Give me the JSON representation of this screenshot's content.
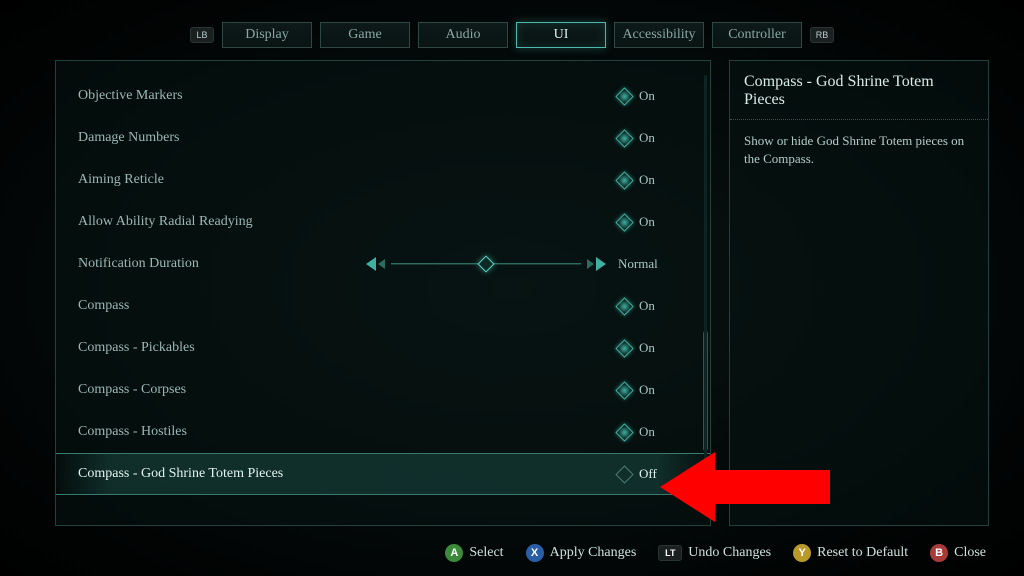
{
  "tabs": {
    "lb": "LB",
    "rb": "RB",
    "items": [
      "Display",
      "Game",
      "Audio",
      "UI",
      "Accessibility",
      "Controller"
    ],
    "active_index": 3
  },
  "settings": [
    {
      "label": "Objective Markers",
      "kind": "toggle",
      "value": "On",
      "on": true
    },
    {
      "label": "Damage Numbers",
      "kind": "toggle",
      "value": "On",
      "on": true
    },
    {
      "label": "Aiming Reticle",
      "kind": "toggle",
      "value": "On",
      "on": true
    },
    {
      "label": "Allow Ability Radial Readying",
      "kind": "toggle",
      "value": "On",
      "on": true
    },
    {
      "label": "Notification Duration",
      "kind": "slider",
      "value": "Normal"
    },
    {
      "label": "Compass",
      "kind": "toggle",
      "value": "On",
      "on": true
    },
    {
      "label": "Compass - Pickables",
      "kind": "toggle",
      "value": "On",
      "on": true
    },
    {
      "label": "Compass - Corpses",
      "kind": "toggle",
      "value": "On",
      "on": true
    },
    {
      "label": "Compass - Hostiles",
      "kind": "toggle",
      "value": "On",
      "on": true
    },
    {
      "label": "Compass - God Shrine Totem Pieces",
      "kind": "toggle",
      "value": "Off",
      "on": false,
      "selected": true
    }
  ],
  "description": {
    "title": "Compass - God Shrine Totem Pieces",
    "body": "Show or hide God Shrine Totem pieces on the Compass."
  },
  "footer": {
    "select": {
      "icon": "A",
      "label": "Select"
    },
    "apply": {
      "icon": "X",
      "label": "Apply Changes"
    },
    "undo": {
      "icon": "LT",
      "label": "Undo Changes"
    },
    "reset": {
      "icon": "Y",
      "label": "Reset to Default"
    },
    "close": {
      "icon": "B",
      "label": "Close"
    }
  }
}
